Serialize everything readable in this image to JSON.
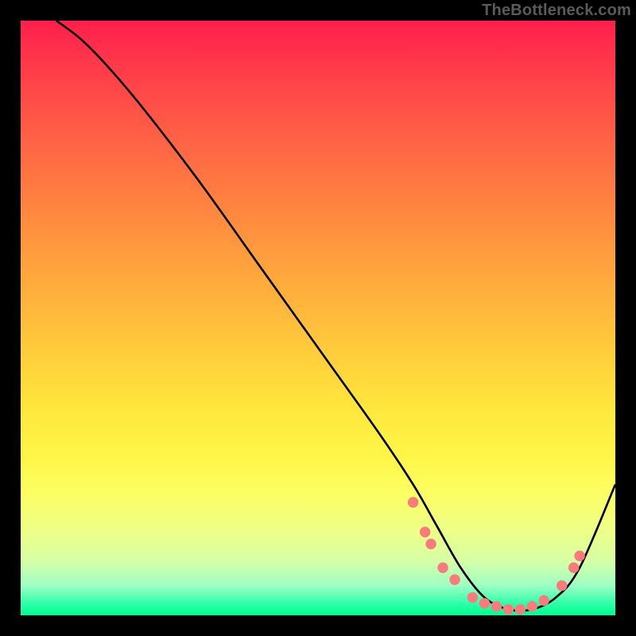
{
  "watermark": "TheBottleneck.com",
  "chart_data": {
    "type": "line",
    "title": "",
    "xlabel": "",
    "ylabel": "",
    "xlim": [
      0,
      100
    ],
    "ylim": [
      0,
      100
    ],
    "gradient_stops": [
      {
        "pct": 0,
        "color": "#ff1f4d"
      },
      {
        "pct": 8,
        "color": "#ff3b4a"
      },
      {
        "pct": 18,
        "color": "#ff5c46"
      },
      {
        "pct": 28,
        "color": "#ff7a41"
      },
      {
        "pct": 38,
        "color": "#ff993e"
      },
      {
        "pct": 48,
        "color": "#ffb63c"
      },
      {
        "pct": 58,
        "color": "#ffd33b"
      },
      {
        "pct": 66,
        "color": "#ffe93d"
      },
      {
        "pct": 74,
        "color": "#fff74a"
      },
      {
        "pct": 80,
        "color": "#fbff66"
      },
      {
        "pct": 86,
        "color": "#edff88"
      },
      {
        "pct": 91,
        "color": "#d5ffa7"
      },
      {
        "pct": 95,
        "color": "#9effc4"
      },
      {
        "pct": 98,
        "color": "#2fffa9"
      },
      {
        "pct": 100,
        "color": "#00ff8e"
      }
    ],
    "series": [
      {
        "name": "bottleneck-curve",
        "color": "#000000",
        "x": [
          6,
          10,
          14,
          20,
          30,
          40,
          50,
          60,
          66,
          70,
          74,
          78,
          82,
          86,
          90,
          94,
          100
        ],
        "y": [
          100,
          97,
          93,
          86,
          73,
          59,
          45,
          31,
          22,
          15,
          8,
          3,
          1,
          1,
          3,
          8,
          22
        ]
      }
    ],
    "markers": {
      "name": "highlight-dots",
      "color": "#f97b7b",
      "points": [
        {
          "x": 66,
          "y": 19
        },
        {
          "x": 68,
          "y": 14
        },
        {
          "x": 69,
          "y": 12
        },
        {
          "x": 71,
          "y": 8
        },
        {
          "x": 73,
          "y": 6
        },
        {
          "x": 76,
          "y": 3
        },
        {
          "x": 78,
          "y": 2
        },
        {
          "x": 80,
          "y": 1.5
        },
        {
          "x": 82,
          "y": 1
        },
        {
          "x": 84,
          "y": 1
        },
        {
          "x": 86,
          "y": 1.5
        },
        {
          "x": 88,
          "y": 2.5
        },
        {
          "x": 91,
          "y": 5
        },
        {
          "x": 93,
          "y": 8
        },
        {
          "x": 94,
          "y": 10
        }
      ]
    }
  }
}
